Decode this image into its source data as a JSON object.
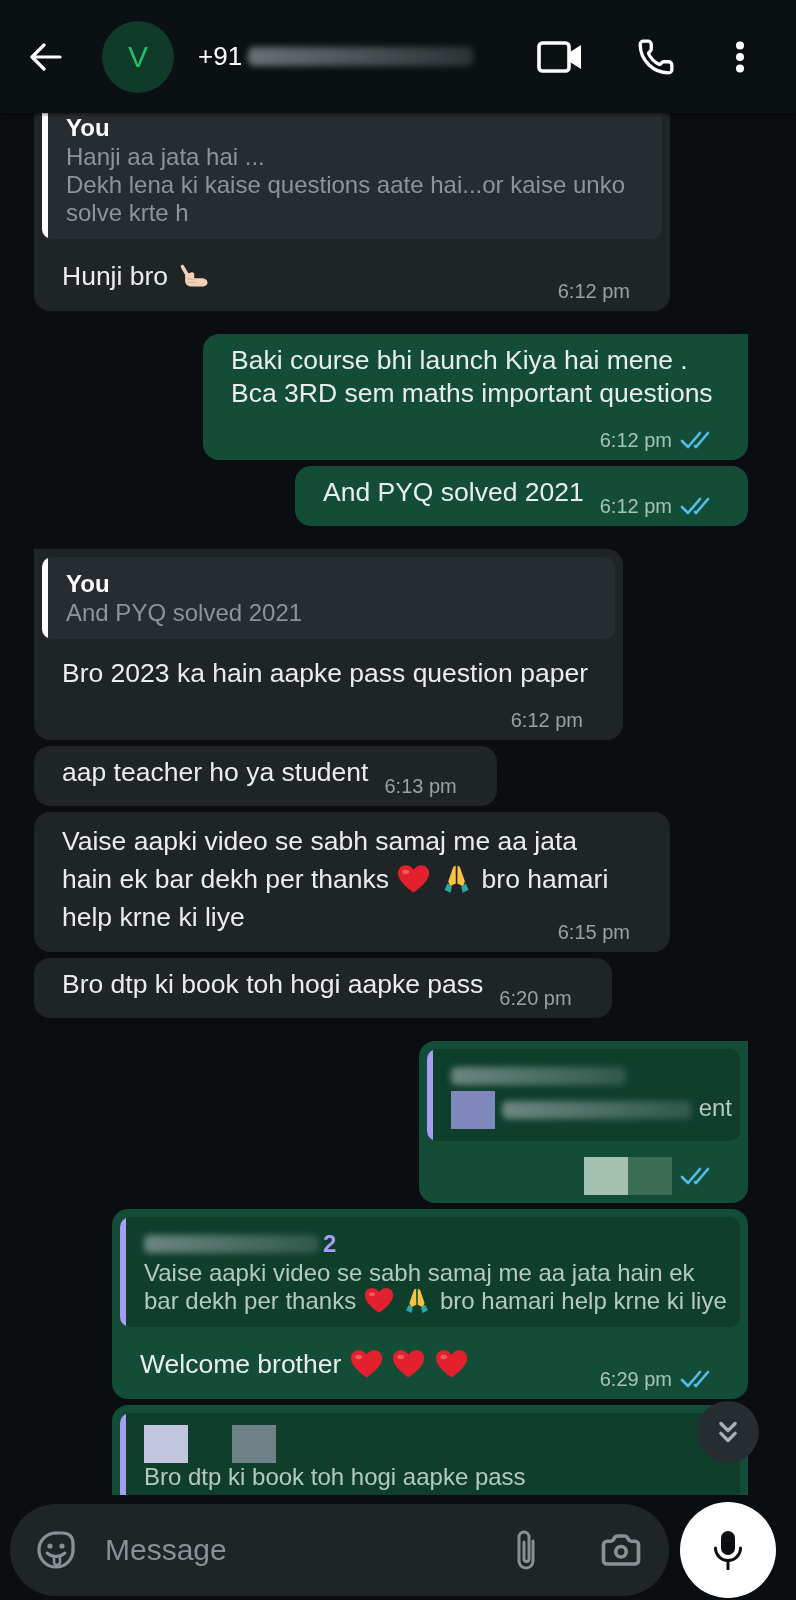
{
  "header": {
    "avatar": "V",
    "title": [
      {
        "kind": "text",
        "text": "+91"
      },
      {
        "kind": "blur"
      }
    ]
  },
  "messages": [
    {
      "kind": "incoming",
      "quote": {
        "color": "#ffffff",
        "sender": [
          {
            "kind": "text",
            "text": "You"
          }
        ],
        "parts": [
          {
            "kind": "text",
            "text": "Hanji aa jata hai ...\nDekh lena ki kaise questions aate hai...or kaise unko solve krte h"
          }
        ]
      },
      "parts": [
        {
          "kind": "text",
          "text": "Hunji bro"
        },
        {
          "kind": "call-hand"
        }
      ],
      "time": "6:12 pm"
    },
    {
      "kind": "outgoing",
      "parts": [
        {
          "kind": "text",
          "text": "Baki course bhi launch Kiya hai mene .\nBca 3RD sem maths important questions"
        }
      ],
      "time": "6:12 pm",
      "read": true
    },
    {
      "kind": "outgoing",
      "parts": [
        {
          "kind": "text",
          "text": "And PYQ solved 2021"
        }
      ],
      "time": "6:12 pm",
      "read": true
    },
    {
      "kind": "incoming",
      "quote": {
        "color": "#ffffff",
        "sender": [
          {
            "kind": "text",
            "text": "You"
          }
        ],
        "parts": [
          {
            "kind": "text",
            "text": "And PYQ solved 2021"
          }
        ]
      },
      "parts": [
        {
          "kind": "text",
          "text": "Bro 2023 ka hain aapke pass question paper"
        }
      ],
      "time": "6:12 pm"
    },
    {
      "kind": "incoming",
      "parts": [
        {
          "kind": "text",
          "text": "aap teacher ho ya student"
        }
      ],
      "time": "6:13 pm"
    },
    {
      "kind": "incoming",
      "parts": [
        {
          "kind": "text",
          "text": "Vaise aapki video se sabh samaj me aa jata"
        },
        {
          "kind": "text",
          "text": "hain ek bar dekh per thanks"
        },
        {
          "kind": "heart"
        },
        {
          "kind": "folded-hands"
        },
        {
          "kind": "text",
          "text": "bro hamari"
        },
        {
          "kind": "text",
          "text": "help krne ki liye"
        }
      ],
      "time": "6:15 pm"
    },
    {
      "kind": "incoming",
      "parts": [
        {
          "kind": "text",
          "text": "Bro dtp ki book toh hogi aapke pass"
        }
      ],
      "time": "6:20 pm"
    },
    {
      "kind": "outgoing",
      "quote": {
        "color": "#a99cf4",
        "sender": [
          {
            "kind": "blur"
          }
        ],
        "parts": [
          {
            "kind": "pixel",
            "color": "#7f87bd"
          },
          {
            "kind": "blur"
          },
          {
            "kind": "text",
            "text": "ent"
          }
        ]
      },
      "time_redacted": [
        {
          "kind": "pixel",
          "color": "#a5c1b1"
        },
        {
          "kind": "pixel",
          "color": "#3b6a55"
        }
      ],
      "read": true
    },
    {
      "kind": "outgoing",
      "quote": {
        "color": "#a99cf4",
        "sender": [
          {
            "kind": "blur"
          },
          {
            "kind": "text",
            "text": "2"
          }
        ],
        "parts": [
          {
            "kind": "text",
            "text": "Vaise aapki video se sabh samaj me aa jata hain ek"
          },
          {
            "kind": "text",
            "text": "bar dekh per thanks"
          },
          {
            "kind": "heart"
          },
          {
            "kind": "folded-hands"
          },
          {
            "kind": "text",
            "text": "bro hamari help krne ki liye"
          }
        ]
      },
      "parts": [
        {
          "kind": "text",
          "text": "Welcome brother"
        },
        {
          "kind": "heart"
        },
        {
          "kind": "heart"
        },
        {
          "kind": "heart"
        }
      ],
      "time": "6:29 pm",
      "read": true
    },
    {
      "kind": "outgoing",
      "quote": {
        "color": "#a99cf4",
        "sender": [
          {
            "kind": "pixel",
            "color": "#c1c6de"
          },
          {
            "kind": "pixel",
            "color": "#6e8187"
          }
        ],
        "parts": [
          {
            "kind": "text",
            "text": "Bro dtp ki book toh hogi aapke pass"
          }
        ]
      }
    }
  ],
  "composer": {
    "placeholder": "Message"
  }
}
